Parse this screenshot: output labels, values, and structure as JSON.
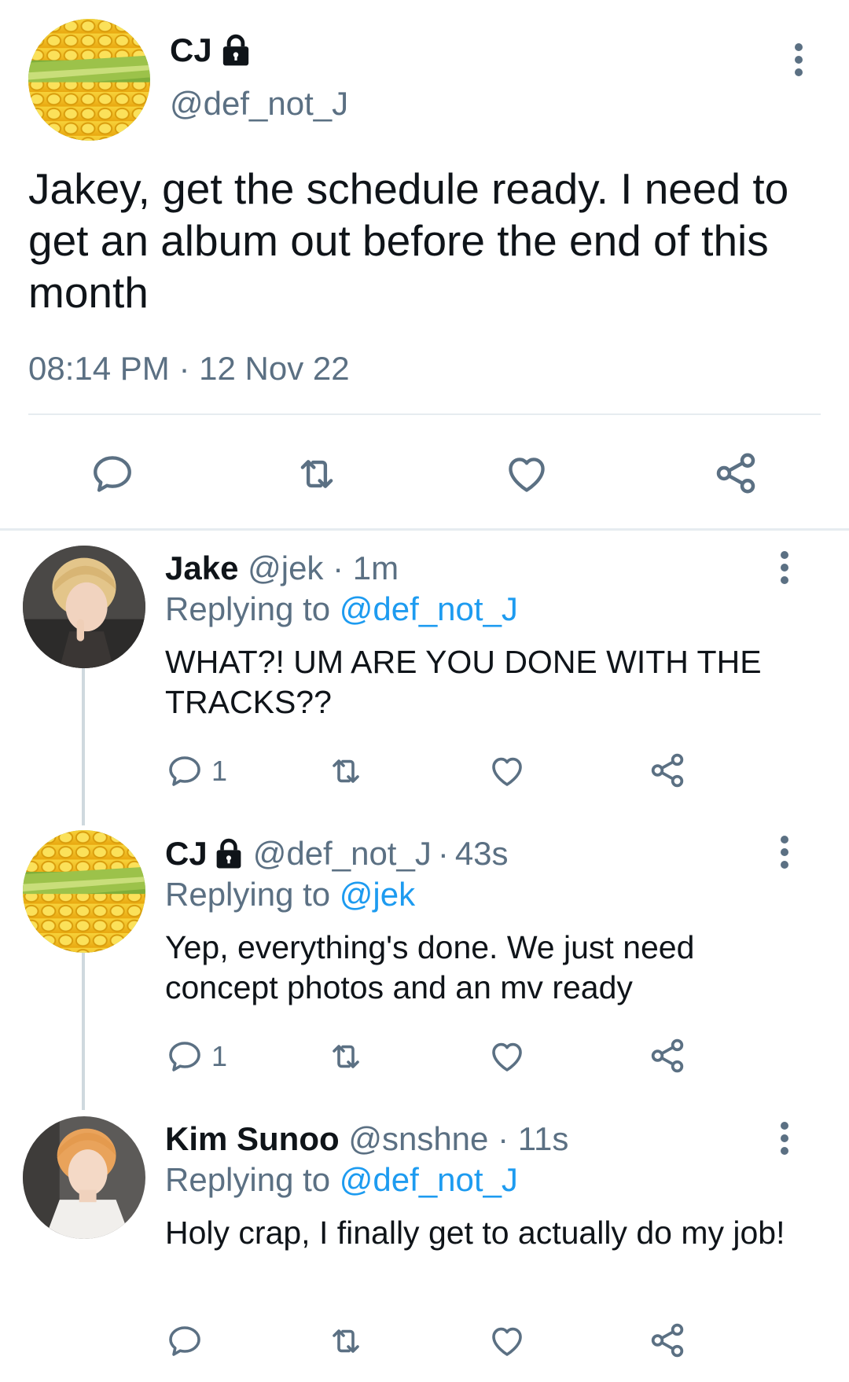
{
  "main_tweet": {
    "author_name": "CJ",
    "handle": "@def_not_J",
    "text": "Jakey, get the schedule ready. I need to get an album out before the end of this month",
    "time": "08:14 PM",
    "date": "12 Nov 22",
    "meta_separator": "·"
  },
  "replies": [
    {
      "name": "Jake",
      "handle": "@jek",
      "age": "1m",
      "replying_label": "Replying to",
      "replying_to": "@def_not_J",
      "text": "WHAT?! UM ARE YOU DONE WITH THE TRACKS??",
      "reply_count": "1"
    },
    {
      "name": "CJ",
      "handle": "@def_not_J",
      "age": "43s",
      "replying_label": "Replying to",
      "replying_to": "@jek",
      "text": "Yep, everything's done. We just need concept photos and an mv ready",
      "reply_count": "1"
    },
    {
      "name": "Kim Sunoo",
      "handle": "@snshne",
      "age": "11s",
      "replying_label": "Replying to",
      "replying_to": "@def_not_J",
      "text": "Holy crap, I finally get to actually do my job!",
      "reply_count": ""
    }
  ],
  "icons": {
    "reply": "speech-bubble-icon",
    "retweet": "retweet-icon",
    "like": "heart-icon",
    "share": "share-icon",
    "more": "more-vertical-icon",
    "protected": "lock-icon"
  },
  "colors": {
    "link": "#1d9bf0",
    "muted": "#5b7083",
    "text": "#0f1419",
    "divider": "#e6ecf0"
  }
}
